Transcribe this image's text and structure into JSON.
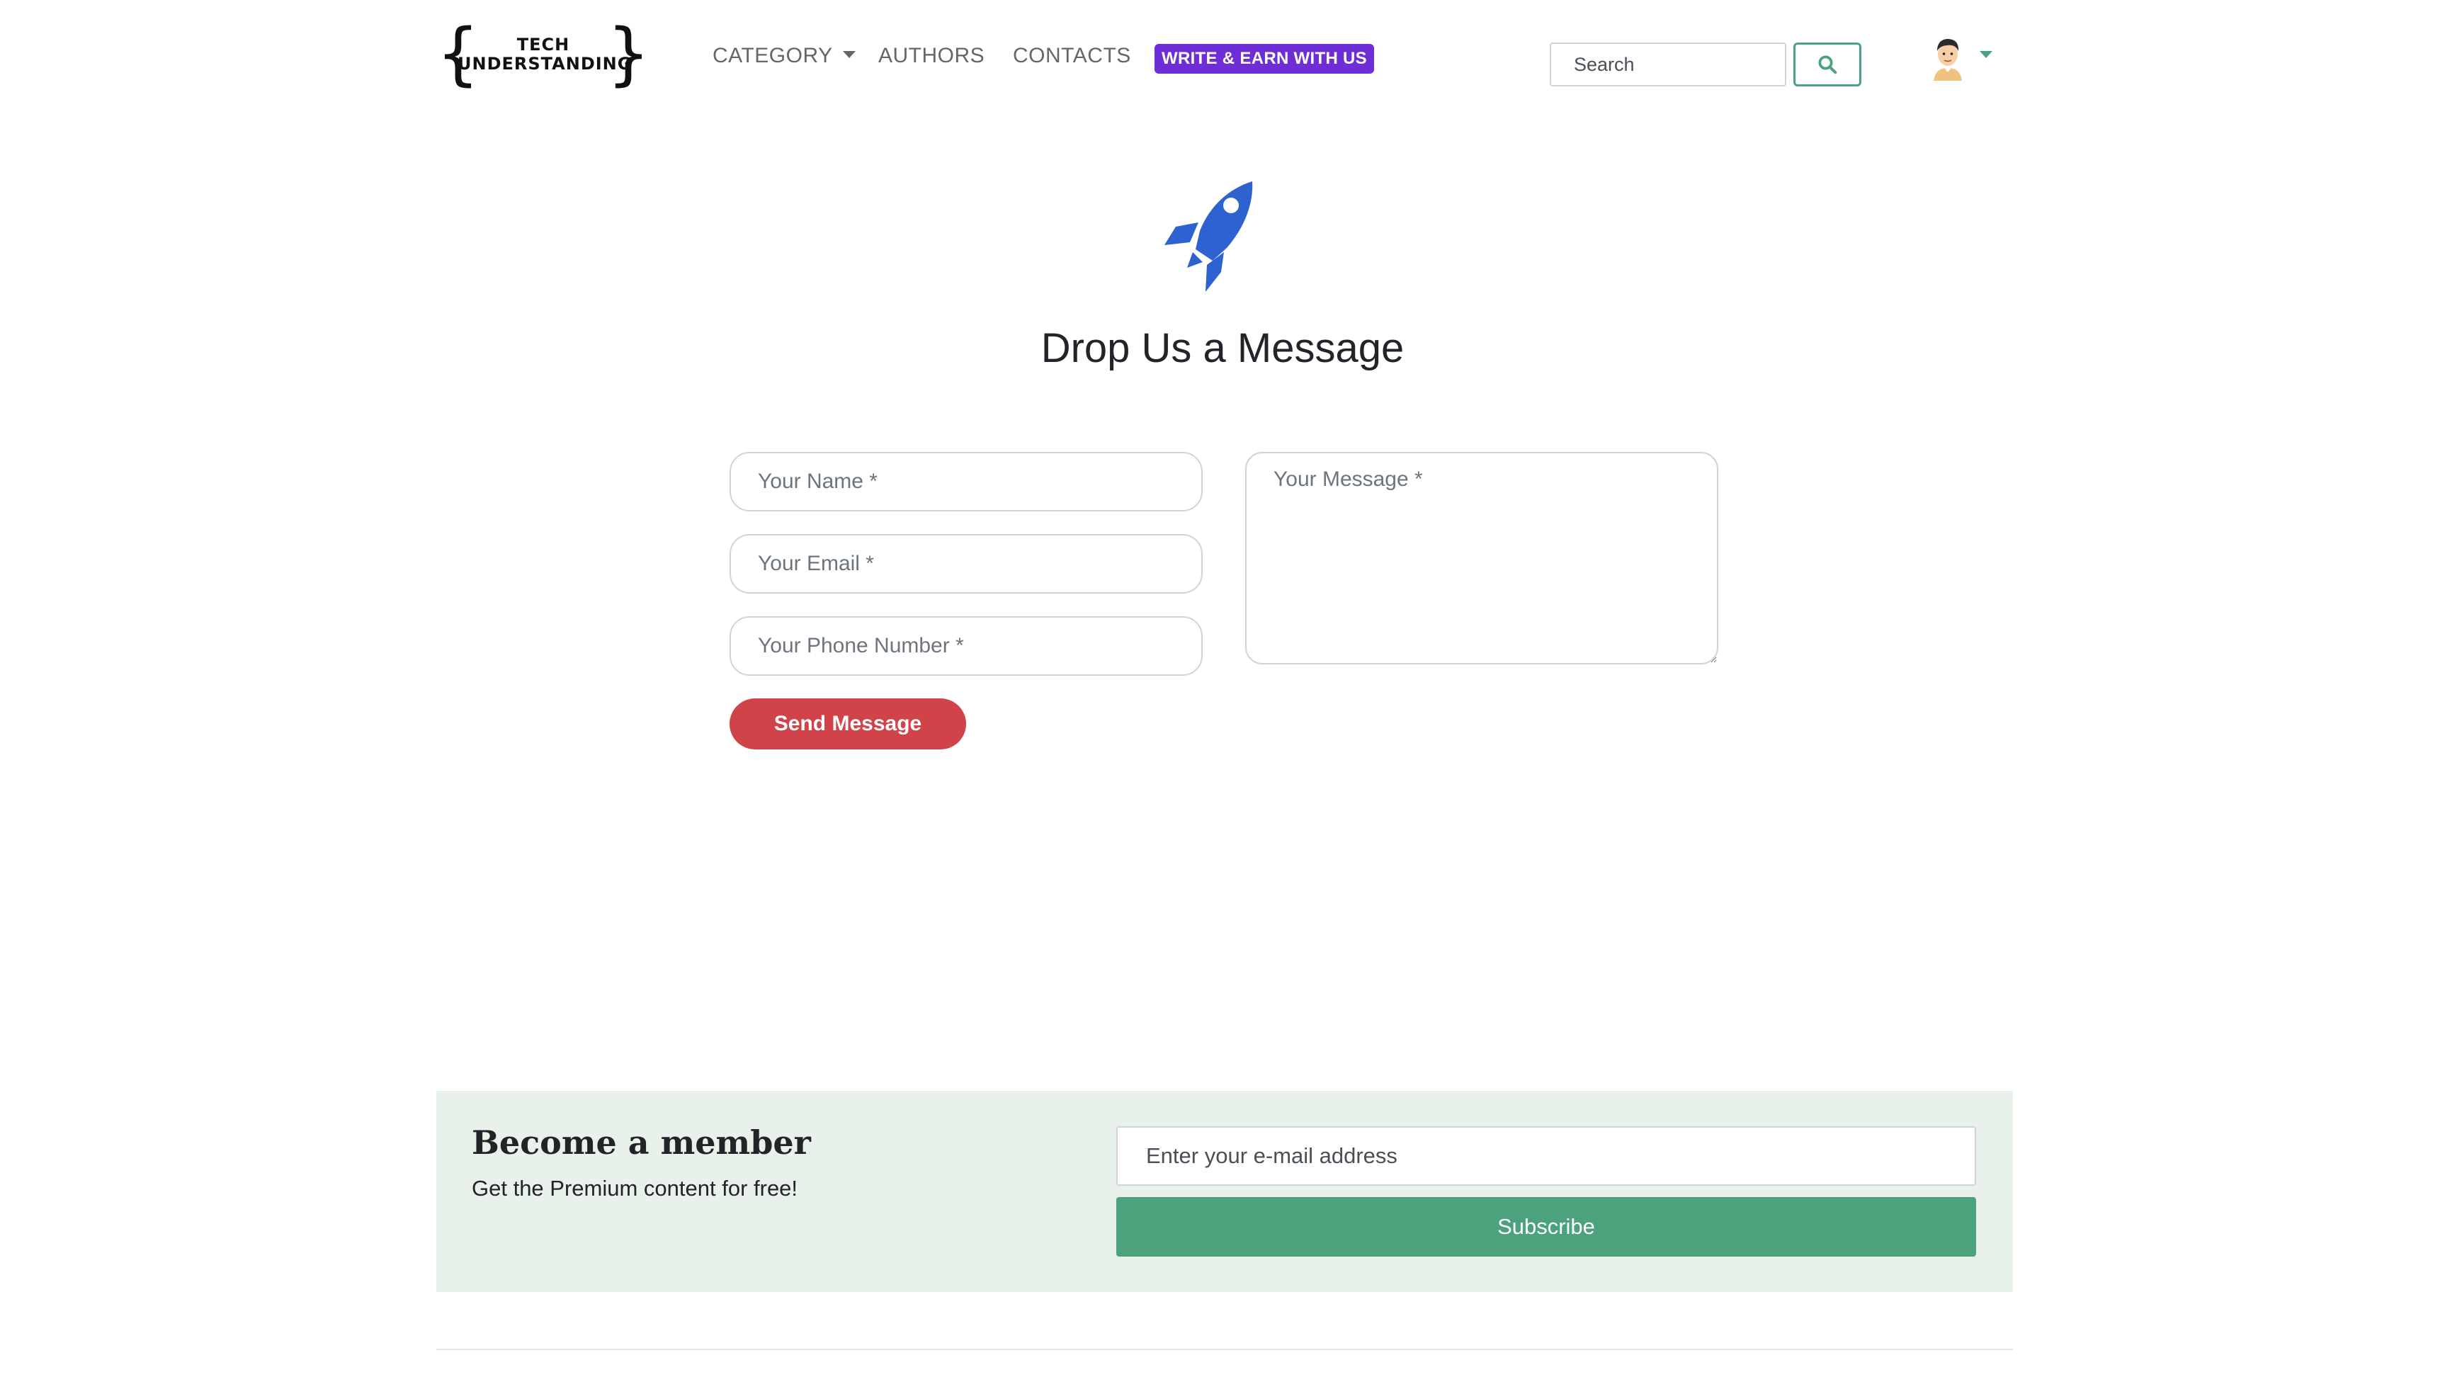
{
  "nav": {
    "logo": {
      "line1": "TECH",
      "line2": "UNDERSTANDING"
    },
    "category": "CATEGORY",
    "authors": "AUTHORS",
    "contacts": "CONTACTS",
    "write_badge": "WRITE & EARN WITH US",
    "search_placeholder": "Search"
  },
  "contact": {
    "title": "Drop Us a Message",
    "name_placeholder": "Your Name *",
    "email_placeholder": "Your Email *",
    "phone_placeholder": "Your Phone Number *",
    "message_placeholder": "Your Message *",
    "send_label": "Send Message"
  },
  "newsletter": {
    "title": "Become a member",
    "subtitle": "Get the Premium content for free!",
    "email_placeholder": "Enter your e-mail address",
    "subscribe_label": "Subscribe"
  },
  "colors": {
    "accent_green": "#4ca27c",
    "badge_purple": "#6f2dd6",
    "send_red": "#d04349",
    "rocket_blue": "#2d62d0",
    "newsletter_bg": "#e8f1ea"
  },
  "icons": {
    "search_button": "search-icon",
    "hero": "rocket-icon",
    "profile": "avatar",
    "dropdown": "caret-down-icon"
  }
}
